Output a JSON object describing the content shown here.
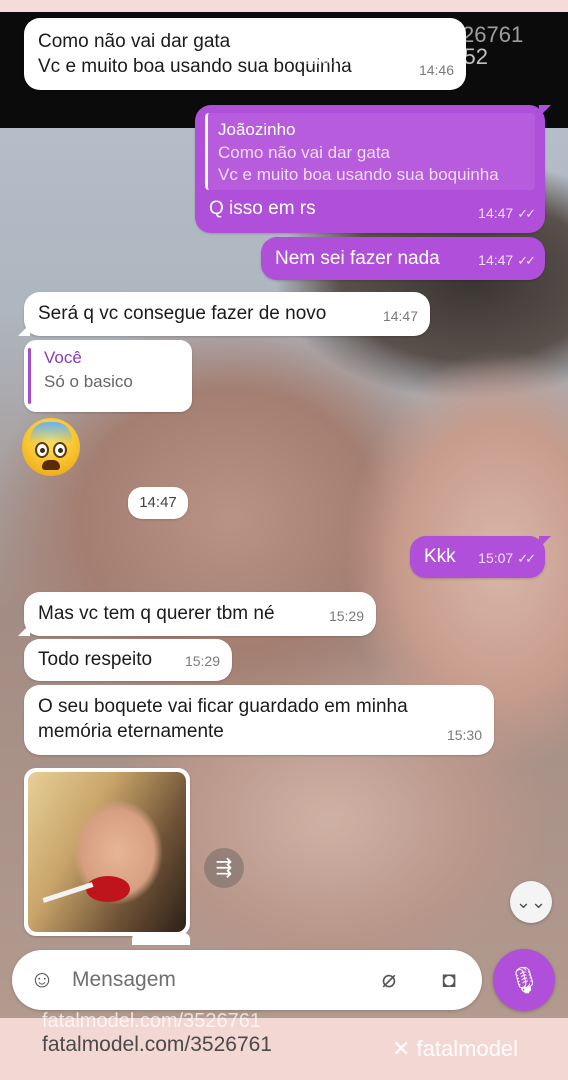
{
  "watermark": {
    "site": "fatalmodel.com/3526761",
    "top_partial": "fatalmodel.com/352",
    "top_number": "26761",
    "logo": "fatalmodel"
  },
  "messages": [
    {
      "id": "m1",
      "dir": "in",
      "lines": [
        "Como não vai dar gata",
        "Vc e muito boa usando sua boquinha"
      ],
      "time": "14:46"
    },
    {
      "id": "m2",
      "dir": "out",
      "quote_name": "Joãozinho",
      "quote_lines": [
        "Como não vai dar gata",
        "Vc e muito boa usando sua boquinha"
      ],
      "text": "Q isso em rs",
      "time": "14:47"
    },
    {
      "id": "m3",
      "dir": "out",
      "text": "Nem sei fazer nada",
      "time": "14:47"
    },
    {
      "id": "m4",
      "dir": "in",
      "text": "Será q vc consegue fazer de novo",
      "time": "14:47"
    },
    {
      "id": "m5",
      "dir": "in",
      "quote_name": "Você",
      "quote_text": "Só o basico"
    },
    {
      "id": "m6",
      "dir": "in",
      "emoji": "😨",
      "time": "14:47"
    },
    {
      "id": "m7",
      "dir": "out",
      "text": "Kkk",
      "time": "15:07"
    },
    {
      "id": "m8",
      "dir": "in",
      "text": "Mas vc tem q querer tbm né",
      "time": "15:29"
    },
    {
      "id": "m9",
      "dir": "in",
      "text": "Todo respeito",
      "time": "15:29"
    },
    {
      "id": "m10",
      "dir": "in",
      "lines": [
        "O seu boquete vai ficar guardado em minha",
        "memória eternamente"
      ],
      "time": "15:30"
    }
  ],
  "composer": {
    "placeholder": "Mensagem"
  },
  "icons": [
    "sticker-icon",
    "attach-icon",
    "camera-icon",
    "mic-icon",
    "forward-icon",
    "scroll-down-icon",
    "read-ticks-icon"
  ],
  "colors": {
    "outgoing": "#b04fd9",
    "incoming": "#ffffff",
    "accent": "#b04fd9"
  }
}
